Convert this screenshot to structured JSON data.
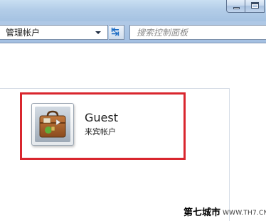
{
  "window": {
    "minimize_icon": "minimize-icon",
    "maximize_icon": "maximize-icon"
  },
  "navbar": {
    "address_text": "管理帐户",
    "dropdown_icon": "chevron-down-icon",
    "refresh_icon": "refresh-icon",
    "search_placeholder": "搜索控制面板"
  },
  "accounts": [
    {
      "name": "Guest",
      "type": "来宾帐户",
      "avatar_icon": "briefcase-avatar-icon"
    }
  ],
  "highlight_color": "#d9262e",
  "watermark": {
    "cn": "第七城市",
    "url": "WWW.TH7.CN"
  }
}
